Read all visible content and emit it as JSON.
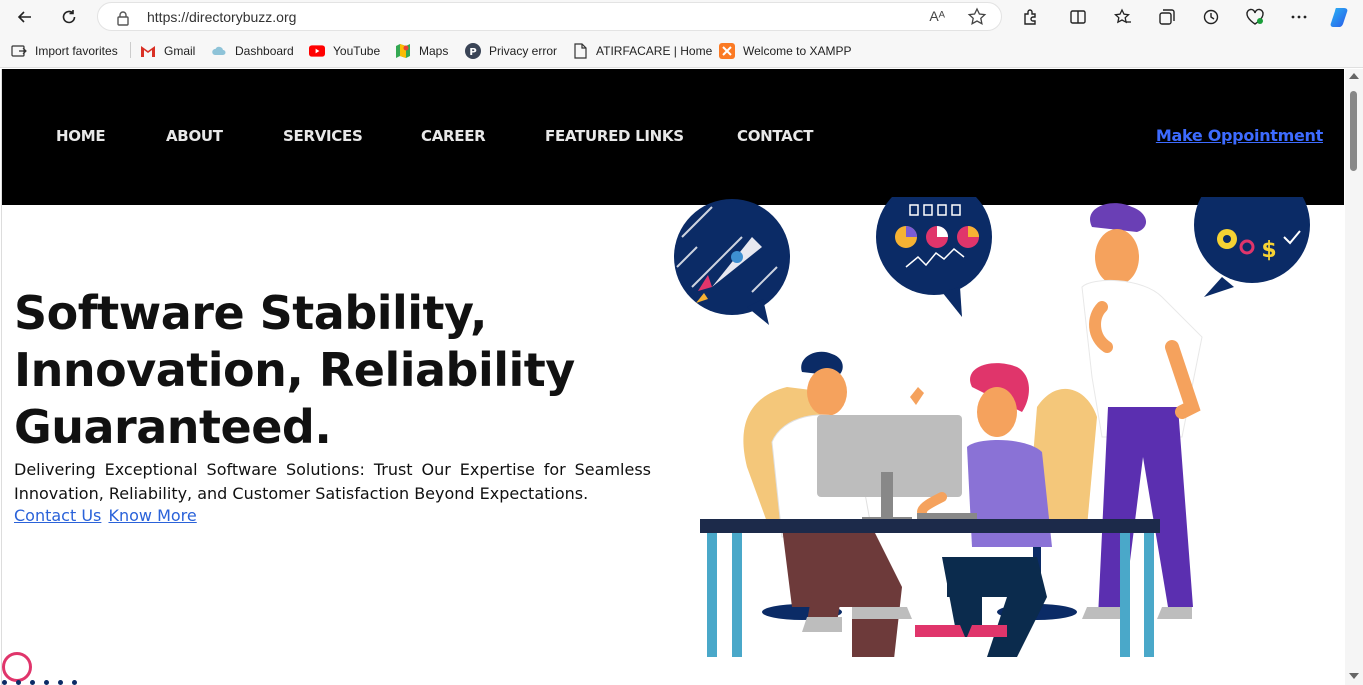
{
  "browser": {
    "url": "https://directorybuzz.org",
    "read_aloud": "Aᴬ",
    "bookmarks": [
      {
        "label": "Import favorites",
        "icon": "import-icon"
      },
      {
        "label": "Gmail",
        "icon": "gmail-icon"
      },
      {
        "label": "Dashboard",
        "icon": "cloud-icon"
      },
      {
        "label": "YouTube",
        "icon": "youtube-icon"
      },
      {
        "label": "Maps",
        "icon": "maps-icon"
      },
      {
        "label": "Privacy error",
        "icon": "p-icon"
      },
      {
        "label": "ATIRFACARE | Home",
        "icon": "page-icon"
      },
      {
        "label": "Welcome to XAMPP",
        "icon": "xampp-icon"
      }
    ]
  },
  "nav": {
    "items": [
      "HOME",
      "ABOUT",
      "SERVICES",
      "CAREER",
      "FEATURED LINKS",
      "CONTACT"
    ],
    "cta": "Make Oppointment"
  },
  "hero": {
    "title": "Software Stability, Innovation, Reliability Guaranteed.",
    "subtitle": "Delivering Exceptional Software Solutions: Trust Our Expertise for Seamless Innovation, Reliability, and Customer Satisfaction Beyond Expectations.",
    "link_contact": "Contact Us",
    "link_more": "Know More"
  },
  "colors": {
    "nav_bg": "#000000",
    "link": "#2a62d9",
    "cta": "#3d6bff",
    "accent_pink": "#e0356b",
    "navy": "#0b2b66"
  }
}
